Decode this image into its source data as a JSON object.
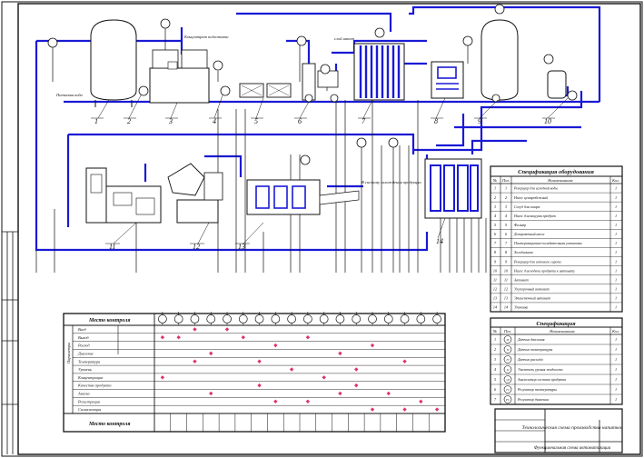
{
  "drawing": {
    "callout_numbers": [
      "1",
      "2",
      "3",
      "4",
      "5",
      "6",
      "7",
      "8",
      "9",
      "10",
      "11",
      "12",
      "13",
      "14"
    ],
    "annotations": {
      "water_in": "Питьевая вода",
      "fruit_top": "Концентрат подготовки",
      "pipe_top": "слой напит",
      "to_cold": "В систему охлаждения продукции"
    }
  },
  "spec_equipment": {
    "title": "Спецификация оборудования",
    "headers": [
      "№",
      "Поз.",
      "Наименование",
      "Кол."
    ],
    "rows": [
      [
        "1",
        "1",
        "Резервуар для исходной воды",
        "1"
      ],
      [
        "2",
        "2",
        "Насос центробежный",
        "1"
      ],
      [
        "3",
        "3",
        "Сосуд для сахара",
        "1"
      ],
      [
        "4",
        "4",
        "Насос для вакуума продукт",
        "1"
      ],
      [
        "5",
        "5",
        "Фильтр",
        "1"
      ],
      [
        "6",
        "6",
        "Дозировочный насос",
        "1"
      ],
      [
        "7",
        "7",
        "Пастеризационно-охладительная установка",
        "1"
      ],
      [
        "8",
        "8",
        "Холодильник",
        "1"
      ],
      [
        "9",
        "9",
        "Резервуар для готового сиропа",
        "1"
      ],
      [
        "10",
        "10",
        "Насос для подачи продукта к автомату",
        "1"
      ],
      [
        "11",
        "11",
        "Автомат",
        "1"
      ],
      [
        "12",
        "12",
        "Укупорочный автомат",
        "1"
      ],
      [
        "13",
        "13",
        "Этикеточный автомат",
        "1"
      ],
      [
        "14",
        "14",
        "Упаковка",
        "1"
      ]
    ]
  },
  "spec_instruments": {
    "title": "Спецификация",
    "headers": [
      "№",
      "Поз.",
      "Наименование",
      "Кол."
    ],
    "rows": [
      [
        "1",
        "PI",
        "Датчик давления",
        "1"
      ],
      [
        "2",
        "TI",
        "Датчик температуры",
        "1"
      ],
      [
        "3",
        "FI",
        "Датчик расхода",
        "1"
      ],
      [
        "4",
        "LI",
        "Указатель уровня жидкости",
        "1"
      ],
      [
        "5",
        "QI",
        "Анализатор состава продукта",
        "1"
      ],
      [
        "6",
        "TC",
        "Регулятор температуры",
        "1"
      ],
      [
        "7",
        "PC",
        "Регулятор давления",
        "1"
      ]
    ]
  },
  "control_table": {
    "header": "Место контроля",
    "row_labels": [
      "Вход",
      "Выход",
      "Расход",
      "Давление",
      "Температура",
      "Уровень",
      "Концентрация",
      "Качество продукта",
      "Анализ",
      "Регистрация",
      "Сигнализация"
    ],
    "side_label": "Параметры",
    "footer": "Место контроля"
  },
  "title_block": {
    "title": "Технологическая схема производства напитков",
    "subtitle": "Функциональная схема автоматизации"
  }
}
